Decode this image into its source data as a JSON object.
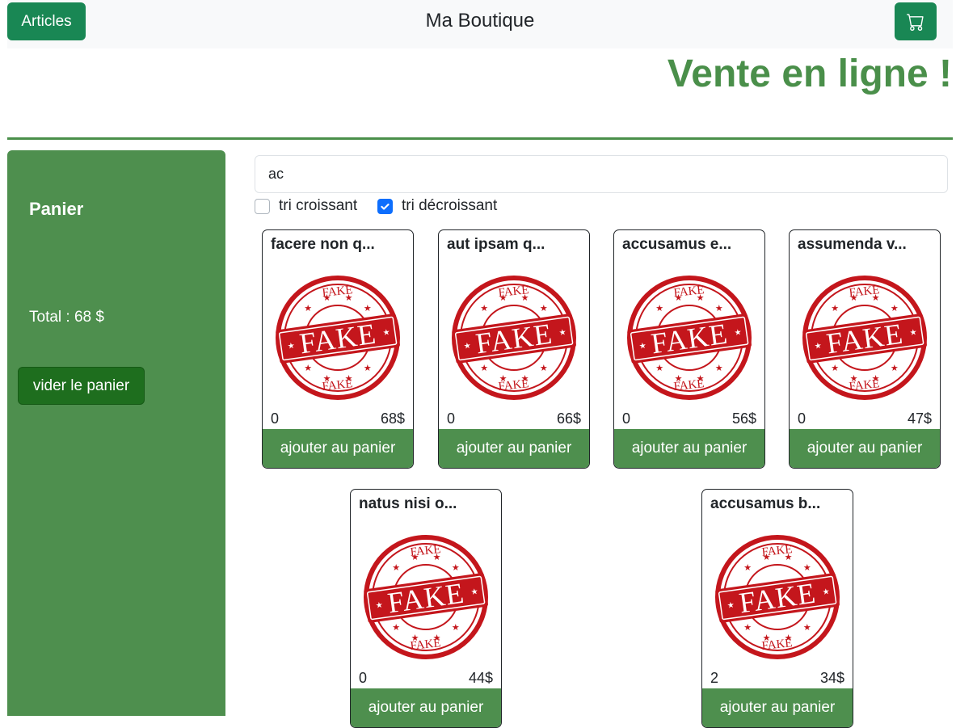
{
  "navbar": {
    "articles_label": "Articles",
    "brand": "Ma Boutique",
    "cart_icon": "cart-icon"
  },
  "headline": "Vente en ligne !",
  "sidebar": {
    "title": "Panier",
    "total": "Total : 68 $",
    "empty_label": "vider le panier"
  },
  "search": {
    "value": "ac"
  },
  "sort": {
    "asc_label": "tri croissant",
    "asc_checked": false,
    "desc_label": "tri décroissant",
    "desc_checked": true
  },
  "products": [
    {
      "title": "facere non q...",
      "qty": "0",
      "price": "68$",
      "add_label": "ajouter au panier"
    },
    {
      "title": "aut ipsam q...",
      "qty": "0",
      "price": "66$",
      "add_label": "ajouter au panier"
    },
    {
      "title": "accusamus e...",
      "qty": "0",
      "price": "56$",
      "add_label": "ajouter au panier"
    },
    {
      "title": "assumenda v...",
      "qty": "0",
      "price": "47$",
      "add_label": "ajouter au panier"
    },
    {
      "title": "natus nisi o...",
      "qty": "0",
      "price": "44$",
      "add_label": "ajouter au panier"
    },
    {
      "title": "accusamus b...",
      "qty": "2",
      "price": "34$",
      "add_label": "ajouter au panier"
    }
  ],
  "stamp": {
    "top_text": "FAKE",
    "main_text": "FAKE",
    "bottom_text": "FAKE",
    "color": "#c4161c"
  },
  "colors": {
    "accent": "#4e8f4e",
    "button": "#198754",
    "checkbox": "#0d6efd"
  }
}
